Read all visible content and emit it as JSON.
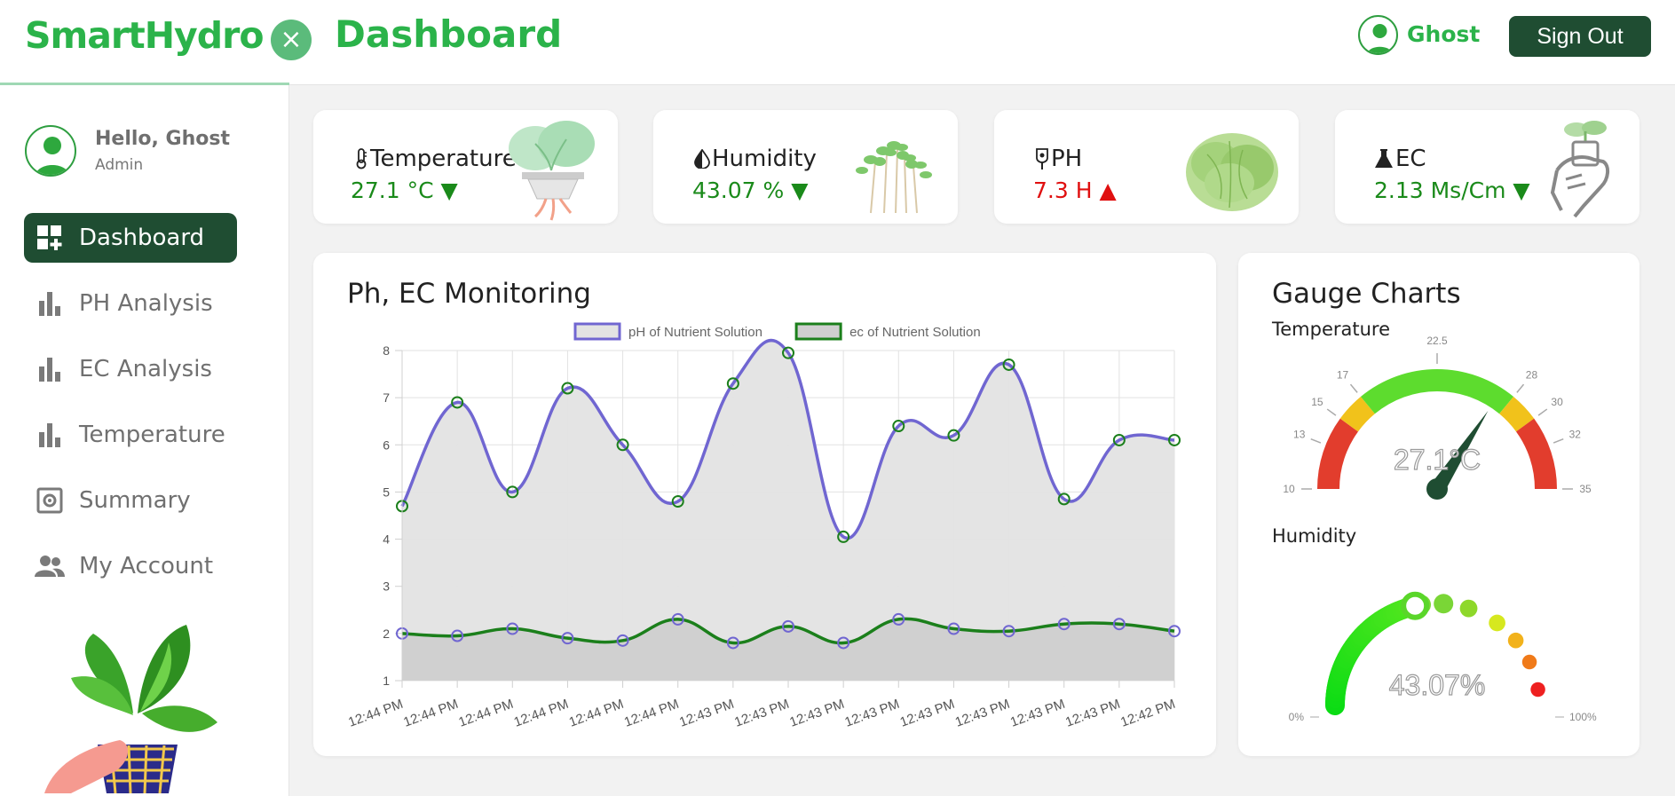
{
  "header": {
    "logo": "SmartHydro",
    "close_symbol": "×",
    "title": "Dashboard",
    "user": "Ghost",
    "sign_out": "Sign Out"
  },
  "sidebar": {
    "greeting": "Hello, Ghost",
    "role": "Admin",
    "items": [
      {
        "label": "Dashboard",
        "icon": "dashboard-add-icon",
        "active": true
      },
      {
        "label": "PH Analysis",
        "icon": "bar-chart-icon",
        "active": false
      },
      {
        "label": "EC Analysis",
        "icon": "bar-chart-icon",
        "active": false
      },
      {
        "label": "Temperature",
        "icon": "bar-chart-icon",
        "active": false
      },
      {
        "label": "Summary",
        "icon": "gear-box-icon",
        "active": false
      },
      {
        "label": "My Account",
        "icon": "users-icon",
        "active": false
      }
    ]
  },
  "stats": [
    {
      "title": "Temperature",
      "value": "27.1 °C",
      "trend": "▼",
      "trend_color": "#1a8a1a",
      "icon": "thermometer-icon"
    },
    {
      "title": "Humidity",
      "value": "43.07 %",
      "trend": "▼",
      "trend_color": "#1a8a1a",
      "icon": "half-drop-icon"
    },
    {
      "title": "PH",
      "value": "7.3 H",
      "trend": "▲",
      "trend_color": "#e01010",
      "icon": "probe-icon"
    },
    {
      "title": "EC",
      "value": "2.13 Ms/Cm",
      "trend": "▼",
      "trend_color": "#1a8a1a",
      "icon": "flask-icon"
    }
  ],
  "monitoring": {
    "title": "Ph, EC Monitoring"
  },
  "chart_data": {
    "type": "line",
    "title": "Ph, EC Monitoring",
    "categories": [
      "12:44 PM",
      "12:44 PM",
      "12:44 PM",
      "12:44 PM",
      "12:44 PM",
      "12:44 PM",
      "12:43 PM",
      "12:43 PM",
      "12:43 PM",
      "12:43 PM",
      "12:43 PM",
      "12:43 PM",
      "12:43 PM",
      "12:43 PM",
      "12:42 PM"
    ],
    "ylim": [
      1,
      8
    ],
    "yticks": [
      1,
      2,
      3,
      4,
      5,
      6,
      7,
      8
    ],
    "grid": true,
    "legend_position": "top",
    "series": [
      {
        "name": "pH of Nutrient Solution",
        "color": "#7066d1",
        "fill": "#e3e3e3",
        "values": [
          4.7,
          6.9,
          5.0,
          7.2,
          6.0,
          4.8,
          7.3,
          7.95,
          4.05,
          6.4,
          6.2,
          7.7,
          4.85,
          6.1,
          6.1
        ]
      },
      {
        "name": "ec of Nutrient Solution",
        "color": "#1b7f1b",
        "fill": "#cfcfcf",
        "values": [
          2.0,
          1.95,
          2.1,
          1.9,
          1.85,
          2.3,
          1.8,
          2.15,
          1.8,
          2.3,
          2.1,
          2.05,
          2.2,
          2.2,
          2.05
        ]
      }
    ]
  },
  "gauges": {
    "title": "Gauge Charts",
    "temperature": {
      "label": "Temperature",
      "value": 27.1,
      "display": "27.1°C",
      "min": 10,
      "max": 35,
      "ticks": [
        "10",
        "13",
        "15",
        "17",
        "22.5",
        "28",
        "30",
        "32",
        "35"
      ],
      "zones": [
        {
          "from": 10,
          "to": 15,
          "color": "#e23d2d"
        },
        {
          "from": 15,
          "to": 17,
          "color": "#f1c21b"
        },
        {
          "from": 17,
          "to": 28,
          "color": "#5ddc2e"
        },
        {
          "from": 28,
          "to": 30,
          "color": "#f1c21b"
        },
        {
          "from": 30,
          "to": 35,
          "color": "#e23d2d"
        }
      ],
      "needle_color": "#1f4d32"
    },
    "humidity": {
      "label": "Humidity",
      "value": 43.07,
      "display": "43.07%",
      "min_label": "0%",
      "max_label": "100%"
    }
  }
}
